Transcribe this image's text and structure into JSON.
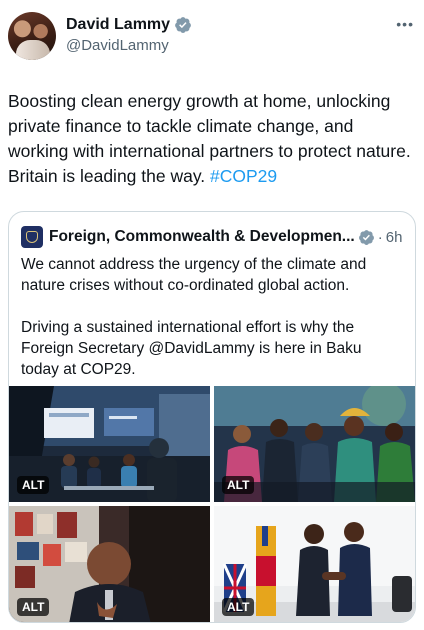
{
  "author": {
    "display_name": "David Lammy",
    "handle": "@DavidLammy",
    "more_label": "•••"
  },
  "tweet": {
    "text_main": "Boosting clean energy growth at home, unlocking private finance to tackle climate change, and working with international partners to protect nature. Britain is leading the way. ",
    "hashtag": "#COP29"
  },
  "quote": {
    "name": "Foreign, Commonwealth & Developmen...",
    "separator": "·",
    "time": "6h",
    "paragraph1": "We cannot address the urgency of the climate and nature crises without co-ordinated global action.",
    "paragraph2": "Driving a sustained international effort is why the Foreign Secretary @DavidLammy is here in Baku today at COP29."
  },
  "media": {
    "alt_badges": [
      "ALT",
      "ALT",
      "ALT",
      "ALT"
    ],
    "photos": [
      "panel-discussion-photo",
      "audience-photo",
      "speaker-portrait-photo",
      "handshake-photo"
    ]
  },
  "colors": {
    "link": "#1d9bf0",
    "verified": "#829aab",
    "text": "#0f1419",
    "muted": "#536471",
    "border": "#cfd9de"
  }
}
